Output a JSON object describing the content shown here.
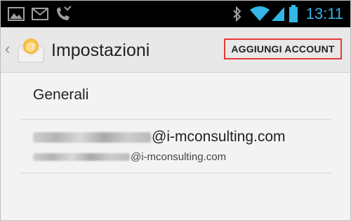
{
  "status_bar": {
    "time": "13:11",
    "icons": [
      "picture-icon",
      "gmail-icon",
      "missed-call-icon",
      "bluetooth-icon",
      "wifi-icon",
      "signal-icon",
      "battery-icon"
    ],
    "accent_color": "#33b5e5"
  },
  "action_bar": {
    "title": "Impostazioni",
    "add_account_label": "AGGIUNGI ACCOUNT",
    "highlight_color": "#e53935"
  },
  "list": {
    "general_label": "Generali",
    "account": {
      "email_suffix": "@i-mconsulting.com",
      "display_suffix": "@i-mconsulting.com"
    }
  }
}
